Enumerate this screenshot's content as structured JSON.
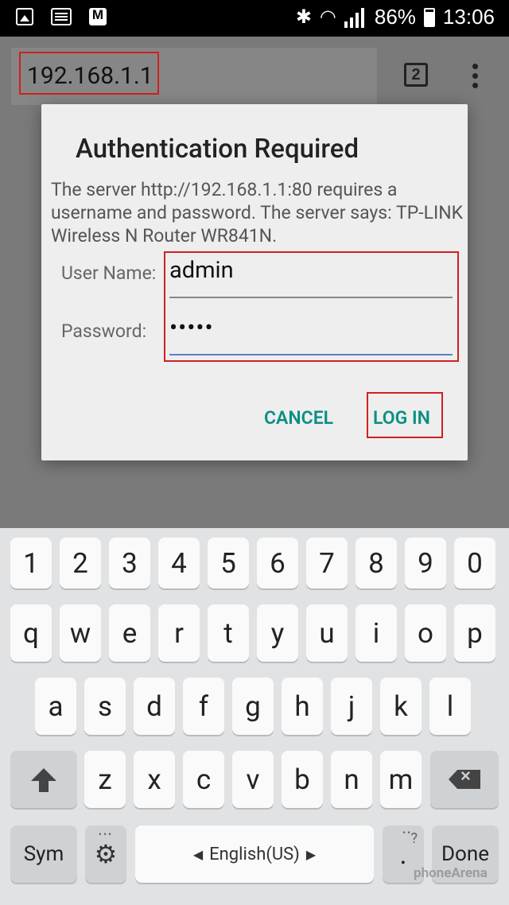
{
  "status_bar": {
    "battery": "86%",
    "time": "13:06",
    "icons": [
      "image-icon",
      "keyboard-icon",
      "gmail-icon",
      "bluetooth-icon",
      "wifi-icon",
      "signal-icon",
      "battery-icon"
    ]
  },
  "browser": {
    "url": "192.168.1.1",
    "tab_count": "2",
    "menu_icon": "overflow-menu-icon"
  },
  "dialog": {
    "title": "Authentication Required",
    "message": "The server http://192.168.1.1:80 requires a username and password. The server says: TP-LINK Wireless N Router WR841N.",
    "username_label": "User Name:",
    "username_value": "admin",
    "password_label": "Password:",
    "password_value": "•••••",
    "cancel_label": "CANCEL",
    "login_label": "LOG IN"
  },
  "keyboard": {
    "row_numbers": [
      "1",
      "2",
      "3",
      "4",
      "5",
      "6",
      "7",
      "8",
      "9",
      "0"
    ],
    "row1": [
      "q",
      "w",
      "e",
      "r",
      "t",
      "y",
      "u",
      "i",
      "o",
      "p"
    ],
    "row2": [
      "a",
      "s",
      "d",
      "f",
      "g",
      "h",
      "j",
      "k",
      "l"
    ],
    "row3": [
      "z",
      "x",
      "c",
      "v",
      "b",
      "n",
      "m"
    ],
    "sym_label": "Sym",
    "language_label": "English(US)",
    "period_label": ".",
    "period_hint": "?",
    "done_label": "Done"
  },
  "watermark": "phoneArena",
  "colors": {
    "accent": "#0a8f83",
    "highlight_red": "#d02020",
    "focus_line": "#5a7fc6"
  }
}
